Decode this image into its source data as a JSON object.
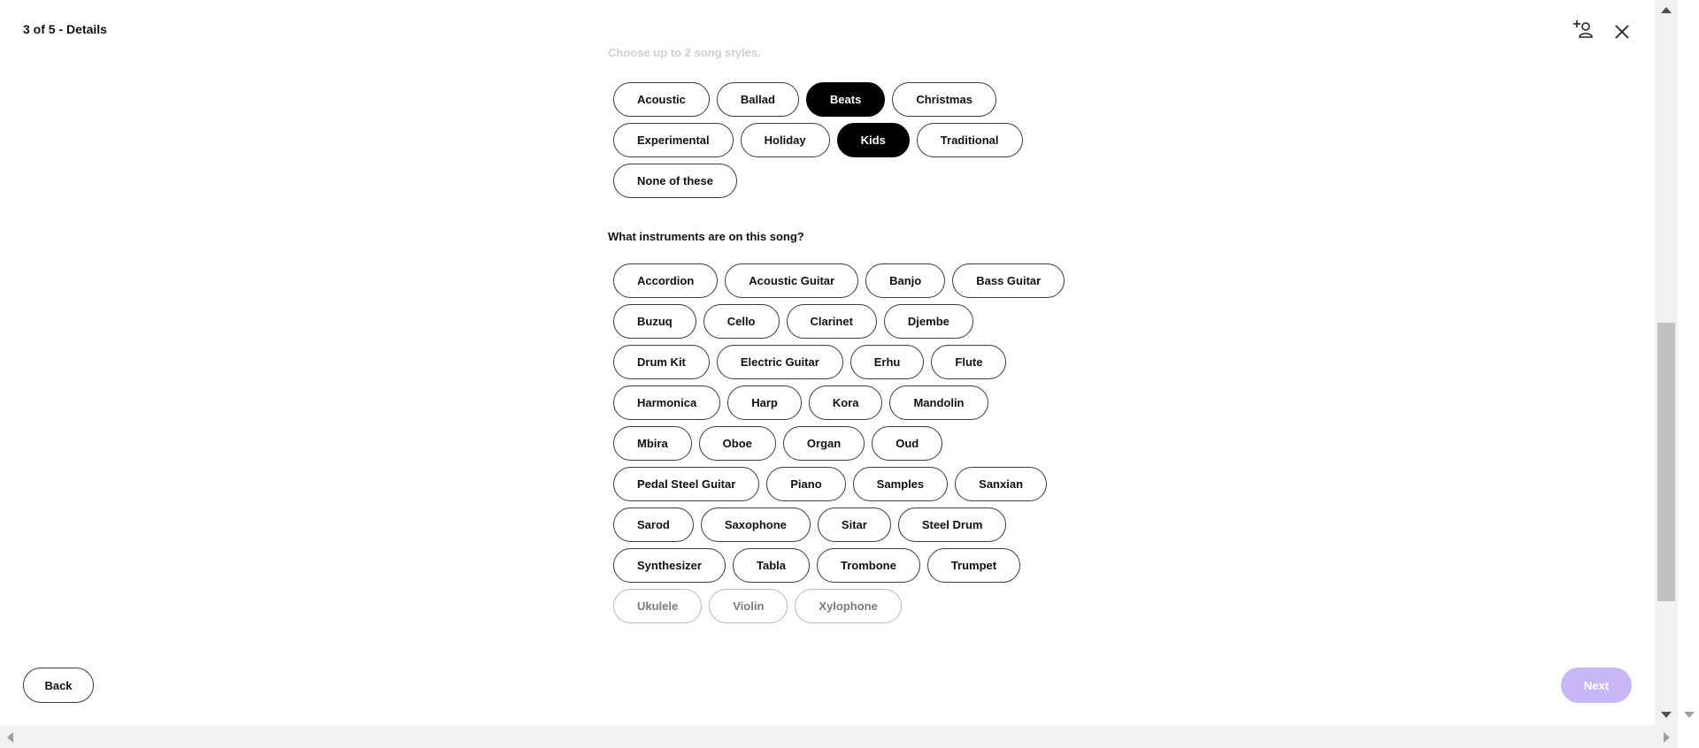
{
  "header": {
    "title": "3 of 5 - Details"
  },
  "styles_section": {
    "prompt": "Choose up to 2 song styles.",
    "options": [
      {
        "label": "Acoustic",
        "selected": false
      },
      {
        "label": "Ballad",
        "selected": false
      },
      {
        "label": "Beats",
        "selected": true
      },
      {
        "label": "Christmas",
        "selected": false
      },
      {
        "label": "Experimental",
        "selected": false
      },
      {
        "label": "Holiday",
        "selected": false
      },
      {
        "label": "Kids",
        "selected": true
      },
      {
        "label": "Traditional",
        "selected": false
      },
      {
        "label": "None of these",
        "selected": false
      }
    ]
  },
  "instruments_section": {
    "question": "What instruments are on this song?",
    "options": [
      "Accordion",
      "Acoustic Guitar",
      "Banjo",
      "Bass Guitar",
      "Buzuq",
      "Cello",
      "Clarinet",
      "Djembe",
      "Drum Kit",
      "Electric Guitar",
      "Erhu",
      "Flute",
      "Harmonica",
      "Harp",
      "Kora",
      "Mandolin",
      "Mbira",
      "Oboe",
      "Organ",
      "Oud",
      "Pedal Steel Guitar",
      "Piano",
      "Samples",
      "Sanxian",
      "Sarod",
      "Saxophone",
      "Sitar",
      "Steel Drum",
      "Synthesizer",
      "Tabla",
      "Trombone",
      "Trumpet",
      "Ukulele",
      "Violin",
      "Xylophone"
    ]
  },
  "footer": {
    "back_label": "Back",
    "next_label": "Next"
  },
  "icons": {
    "add_collaborator": "add-person-icon",
    "close": "close-icon"
  },
  "colors": {
    "selected_chip": "#000000",
    "next_disabled": "#c8b6f7"
  }
}
